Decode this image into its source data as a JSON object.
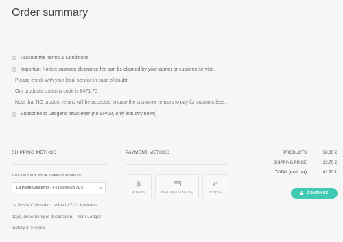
{
  "page_title": "Order summary",
  "agreements": {
    "terms_label": "I accept the Terms & Conditions",
    "notice_label": "Important Notice: customs clearance fee can be claimed by your carrier or customs service.",
    "notice_lines": [
      "Please check with your local service in case of doubt",
      "Our products customs code is 8471.70",
      "Note that NO product refund will be accepted in case the customer refuses to pay for customs fees."
    ],
    "newsletter_label": "Subscribe to Ledger's newsletter (no SPAM, only industry news)"
  },
  "shipping": {
    "heading": "SHIPPING METHOD",
    "address_label": "AVAILABLE FOR YOUR SHIPPING ADDRESS:",
    "selected_option": "La Poste Colissimo : 7-21 days [23.70 €]",
    "description": "La Poste Colissimo : ships in 7-21 business days, depending of destination. , from Ledger factory in France"
  },
  "payment": {
    "heading": "PAYMENT METHOD",
    "methods": [
      {
        "label": "BITCOIN",
        "icon": "bitcoin-icon"
      },
      {
        "label": "VISA, MASTERCARD",
        "icon": "credit-card-icon"
      },
      {
        "label": "PAYPAL",
        "icon": "paypal-icon"
      }
    ]
  },
  "totals": {
    "products_label": "PRODUCTS",
    "products_value": "58.00 €",
    "shipping_label": "SHIPPING PRICE",
    "shipping_value": "23.70 €",
    "total_label": "TOTAL (excl. tax)",
    "total_value": "81.70 €"
  },
  "continue_label": "CONTINUE",
  "colors": {
    "accent": "#40c9b3",
    "background": "#f6f6f6"
  }
}
